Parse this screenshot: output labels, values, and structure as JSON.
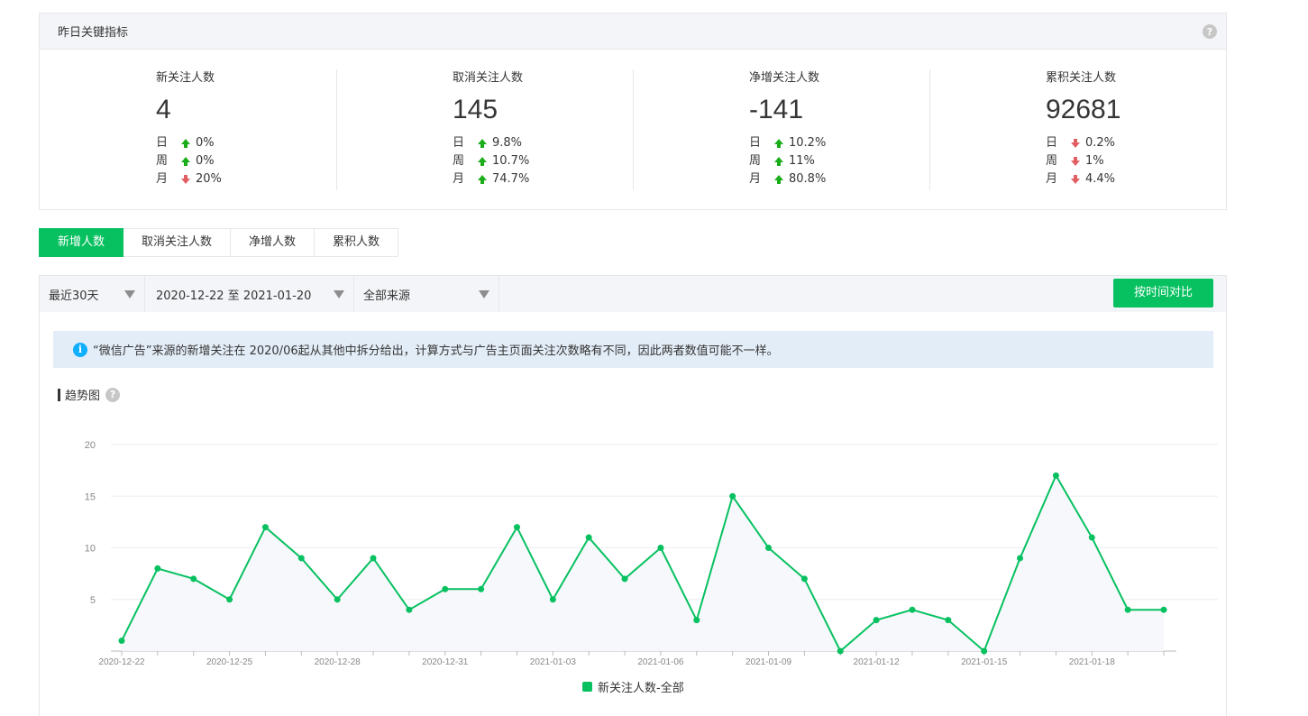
{
  "kpi": {
    "title": "昨日关键指标",
    "help": "?",
    "metrics": [
      {
        "label": "新关注人数",
        "value": "4",
        "rows": [
          {
            "period": "日",
            "dir": "up",
            "pct": "0%"
          },
          {
            "period": "周",
            "dir": "up",
            "pct": "0%"
          },
          {
            "period": "月",
            "dir": "down",
            "pct": "20%"
          }
        ]
      },
      {
        "label": "取消关注人数",
        "value": "145",
        "rows": [
          {
            "period": "日",
            "dir": "up",
            "pct": "9.8%"
          },
          {
            "period": "周",
            "dir": "up",
            "pct": "10.7%"
          },
          {
            "period": "月",
            "dir": "up",
            "pct": "74.7%"
          }
        ]
      },
      {
        "label": "净增关注人数",
        "value": "-141",
        "rows": [
          {
            "period": "日",
            "dir": "up",
            "pct": "10.2%"
          },
          {
            "period": "周",
            "dir": "up",
            "pct": "11%"
          },
          {
            "period": "月",
            "dir": "up",
            "pct": "80.8%"
          }
        ]
      },
      {
        "label": "累积关注人数",
        "value": "92681",
        "rows": [
          {
            "period": "日",
            "dir": "down",
            "pct": "0.2%"
          },
          {
            "period": "周",
            "dir": "down",
            "pct": "1%"
          },
          {
            "period": "月",
            "dir": "down",
            "pct": "4.4%"
          }
        ]
      }
    ]
  },
  "tabs": [
    {
      "label": "新增人数",
      "active": true
    },
    {
      "label": "取消关注人数",
      "active": false
    },
    {
      "label": "净增人数",
      "active": false
    },
    {
      "label": "累积人数",
      "active": false
    }
  ],
  "filters": {
    "range": "最近30天",
    "dates": "2020-12-22 至 2021-01-20",
    "source": "全部来源",
    "compare_button": "按时间对比"
  },
  "notice": {
    "icon": "i",
    "text": "“微信广告”来源的新增关注在 2020/06起从其他中拆分给出，计算方式与广告主页面关注次数略有不同，因此两者数值可能不一样。"
  },
  "trend": {
    "title": "趋势图",
    "help": "?"
  },
  "colors": {
    "accent": "#07c160",
    "up": "#1aad19",
    "down": "#e15f63",
    "info": "#10aeff"
  },
  "chart_data": {
    "type": "line",
    "x": [
      "2020-12-22",
      "2020-12-23",
      "2020-12-24",
      "2020-12-25",
      "2020-12-26",
      "2020-12-27",
      "2020-12-28",
      "2020-12-29",
      "2020-12-30",
      "2020-12-31",
      "2021-01-01",
      "2021-01-02",
      "2021-01-03",
      "2021-01-04",
      "2021-01-05",
      "2021-01-06",
      "2021-01-07",
      "2021-01-08",
      "2021-01-09",
      "2021-01-10",
      "2021-01-11",
      "2021-01-12",
      "2021-01-13",
      "2021-01-14",
      "2021-01-15",
      "2021-01-16",
      "2021-01-17",
      "2021-01-18",
      "2021-01-19",
      "2021-01-20"
    ],
    "tick_labels": [
      "2020-12-22",
      "2020-12-25",
      "2020-12-28",
      "2020-12-31",
      "2021-01-03",
      "2021-01-06",
      "2021-01-09",
      "2021-01-12",
      "2021-01-15",
      "2021-01-18"
    ],
    "series": [
      {
        "name": "新关注人数-全部",
        "values": [
          1,
          8,
          7,
          5,
          12,
          9,
          5,
          9,
          4,
          6,
          6,
          12,
          5,
          11,
          7,
          10,
          3,
          15,
          10,
          7,
          0,
          3,
          4,
          3,
          0,
          9,
          17,
          11,
          4,
          4
        ]
      }
    ],
    "yticks": [
      5,
      10,
      15,
      20
    ],
    "ylim": [
      0,
      20
    ],
    "grid": true,
    "legend": "bottom-center"
  }
}
